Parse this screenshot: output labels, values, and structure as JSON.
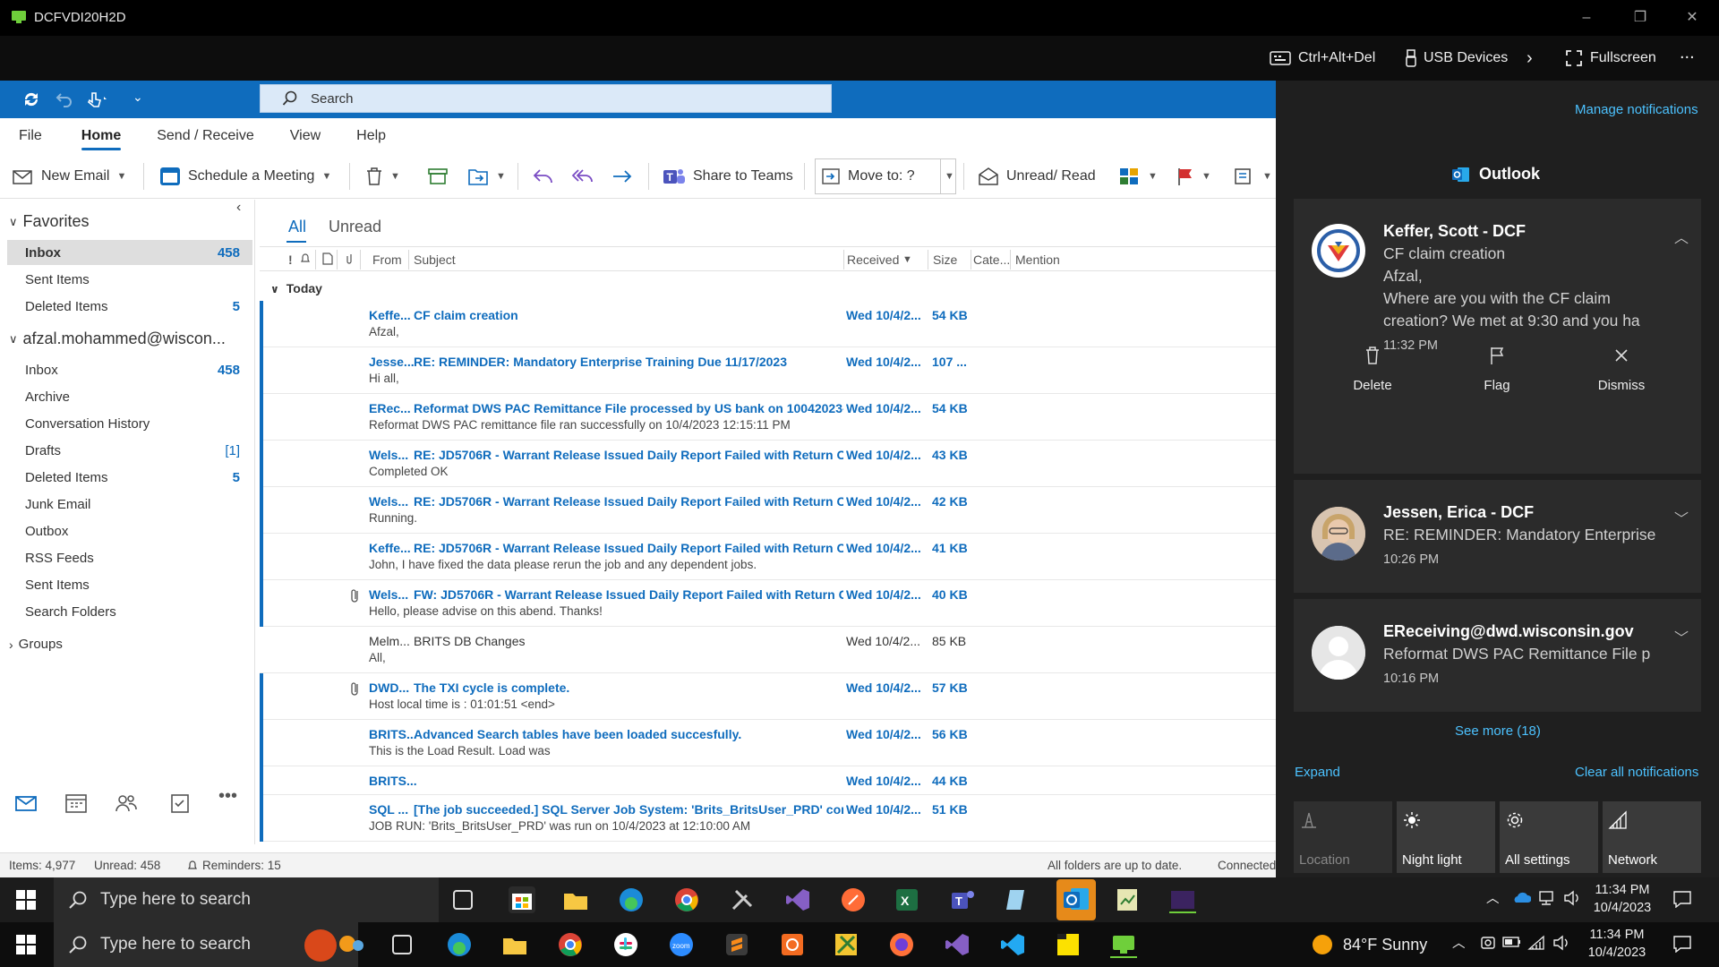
{
  "remote": {
    "window_title": "DCFVDI20H2D",
    "toolbar": {
      "ctrl_alt_del": "Ctrl+Alt+Del",
      "usb_devices": "USB Devices",
      "fullscreen": "Fullscreen",
      "more": "..."
    }
  },
  "outlook": {
    "search_placeholder": "Search",
    "menus": [
      "File",
      "Home",
      "Send / Receive",
      "View",
      "Help"
    ],
    "active_menu": "Home",
    "ribbon": {
      "new_email": "New Email",
      "schedule_meeting": "Schedule a Meeting",
      "share_to_teams": "Share to Teams",
      "move_to": "Move to: ?",
      "unread_read": "Unread/ Read"
    },
    "folders": {
      "favorites_label": "Favorites",
      "favorites": [
        {
          "name": "Inbox",
          "count": "458",
          "selected": true
        },
        {
          "name": "Sent Items",
          "count": ""
        },
        {
          "name": "Deleted Items",
          "count": "5"
        }
      ],
      "account_label": "afzal.mohammed@wiscon...",
      "account": [
        {
          "name": "Inbox",
          "count": "458"
        },
        {
          "name": "Archive",
          "count": ""
        },
        {
          "name": "Conversation History",
          "count": ""
        },
        {
          "name": "Drafts",
          "count": "[1]"
        },
        {
          "name": "Deleted Items",
          "count": "5"
        },
        {
          "name": "Junk Email",
          "count": ""
        },
        {
          "name": "Outbox",
          "count": ""
        },
        {
          "name": "RSS Feeds",
          "count": ""
        },
        {
          "name": "Sent Items",
          "count": ""
        },
        {
          "name": "Search Folders",
          "count": ""
        }
      ],
      "groups_label": "Groups"
    },
    "list": {
      "tab_all": "All",
      "tab_unread": "Unread",
      "columns": {
        "from": "From",
        "subject": "Subject",
        "received": "Received",
        "size": "Size",
        "categories": "Cate...",
        "mention": "Mention"
      },
      "group_today": "Today",
      "messages": [
        {
          "from": "Keffe...",
          "subject": "CF claim creation",
          "preview": "Afzal,",
          "received": "Wed 10/4/2...",
          "size": "54 KB",
          "unread": true,
          "attachment": false
        },
        {
          "from": "Jesse...",
          "subject": "RE: REMINDER: Mandatory Enterprise Training Due 11/17/2023",
          "preview": "Hi all,",
          "received": "Wed 10/4/2...",
          "size": "107 ...",
          "unread": true,
          "attachment": false
        },
        {
          "from": "ERec...",
          "subject": "Reformat DWS PAC Remittance File processed by US bank on 10042023-...",
          "preview": "Reformat DWS PAC remittance file ran successfully on 10/4/2023 12:15:11 PM",
          "received": "Wed 10/4/2...",
          "size": "54 KB",
          "unread": true,
          "attachment": false
        },
        {
          "from": "Wels...",
          "subject": "RE: JD5706R - Warrant Release Issued Daily Report Failed with Return C...",
          "preview": "Completed OK",
          "received": "Wed 10/4/2...",
          "size": "43 KB",
          "unread": true,
          "attachment": false
        },
        {
          "from": "Wels...",
          "subject": "RE: JD5706R - Warrant Release Issued Daily Report Failed with Return C...",
          "preview": "Running.",
          "received": "Wed 10/4/2...",
          "size": "42 KB",
          "unread": true,
          "attachment": false
        },
        {
          "from": "Keffe...",
          "subject": "RE: JD5706R - Warrant Release Issued Daily Report Failed with Return C...",
          "preview": "John,  I have fixed the data please rerun the job and any dependent jobs.",
          "received": "Wed 10/4/2...",
          "size": "41 KB",
          "unread": true,
          "attachment": false
        },
        {
          "from": "Wels...",
          "subject": "FW: JD5706R - Warrant Release Issued Daily Report Failed with Return C...",
          "preview": "Hello, please advise on this abend. Thanks!",
          "received": "Wed 10/4/2...",
          "size": "40 KB",
          "unread": true,
          "attachment": true
        },
        {
          "from": "Melm...",
          "subject": "BRITS DB Changes",
          "preview": "All,",
          "received": "Wed 10/4/2...",
          "size": "85 KB",
          "unread": false,
          "attachment": false
        },
        {
          "from": "DWD...",
          "subject": "The TXI cycle is complete.",
          "preview": "Host local time is : 01:01:51 <end>",
          "received": "Wed 10/4/2...",
          "size": "57 KB",
          "unread": true,
          "attachment": true
        },
        {
          "from": "BRITS...",
          "subject": "Advanced Search tables have been loaded succesfully.",
          "preview": "This is the Load Result. Load was",
          "received": "Wed 10/4/2...",
          "size": "56 KB",
          "unread": true,
          "attachment": false
        },
        {
          "from": "BRITS...",
          "subject": "",
          "preview": "",
          "received": "Wed 10/4/2...",
          "size": "44 KB",
          "unread": true,
          "attachment": false
        },
        {
          "from": "SQL ...",
          "subject": "[The job succeeded.] SQL Server Job System: 'Brits_BritsUser_PRD' comp...",
          "preview": "JOB RUN:               'Brits_BritsUser_PRD' was run on 10/4/2023 at 12:10:00 AM",
          "received": "Wed 10/4/2...",
          "size": "51 KB",
          "unread": true,
          "attachment": false
        }
      ]
    },
    "status": {
      "items": "Items: 4,977",
      "unread": "Unread: 458",
      "reminders": "Reminders: 15",
      "sync": "All folders are up to date.",
      "connected": "Connected"
    }
  },
  "action_center": {
    "manage": "Manage notifications",
    "app_name": "Outlook",
    "notifications": [
      {
        "sender": "Keffer, Scott - DCF",
        "lines": [
          "CF claim creation",
          "Afzal,",
          "Where are you with the CF claim",
          "creation?   We met at 9:30 and you ha"
        ],
        "time": "11:32 PM"
      },
      {
        "sender": "Jessen, Erica - DCF",
        "lines": [
          "RE: REMINDER: Mandatory Enterprise"
        ],
        "time": "10:26 PM"
      },
      {
        "sender": "EReceiving@dwd.wisconsin.gov",
        "lines": [
          "Reformat DWS PAC Remittance File p"
        ],
        "time": "10:16 PM"
      }
    ],
    "actions": {
      "delete": "Delete",
      "flag": "Flag",
      "dismiss": "Dismiss"
    },
    "see_more": "See more (18)",
    "expand": "Expand",
    "clear_all": "Clear all notifications",
    "quick_actions": [
      "Location",
      "Night light",
      "All settings",
      "Network"
    ]
  },
  "taskbar_inner": {
    "search_placeholder": "Type here to search",
    "time": "11:34 PM",
    "date": "10/4/2023"
  },
  "taskbar_outer": {
    "search_placeholder": "Type here to search",
    "weather": "84°F  Sunny",
    "time": "11:34 PM",
    "date": "10/4/2023"
  },
  "colors": {
    "outlook_blue": "#0f6cbd",
    "link_blue": "#4cc2ff",
    "action_center_bg": "#1f1f1f"
  }
}
